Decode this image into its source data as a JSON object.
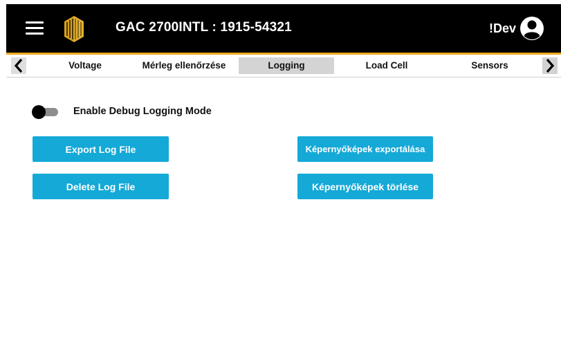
{
  "header": {
    "title": "GAC 2700INTL : 1915-54321",
    "user": "!Dev",
    "accent_color": "#f0a81a"
  },
  "icons": {
    "menu": "hamburger-menu-icon",
    "logo": "gac-logo-icon",
    "user": "user-account-icon",
    "prev": "chevron-left-icon",
    "next": "chevron-right-icon"
  },
  "tabs": [
    {
      "label": "Voltage",
      "active": false
    },
    {
      "label": "Mérleg ellenőrzése",
      "active": false
    },
    {
      "label": "Logging",
      "active": true
    },
    {
      "label": "Load Cell",
      "active": false
    },
    {
      "label": "Sensors",
      "active": false
    }
  ],
  "debug_toggle": {
    "label": "Enable Debug Logging Mode",
    "enabled": false
  },
  "buttons": {
    "export_log": "Export Log File",
    "delete_log": "Delete Log File",
    "export_screenshots": "Képernyőképek exportálása",
    "delete_screenshots": "Képernyőképek törlése",
    "color": "#14a9d7"
  }
}
